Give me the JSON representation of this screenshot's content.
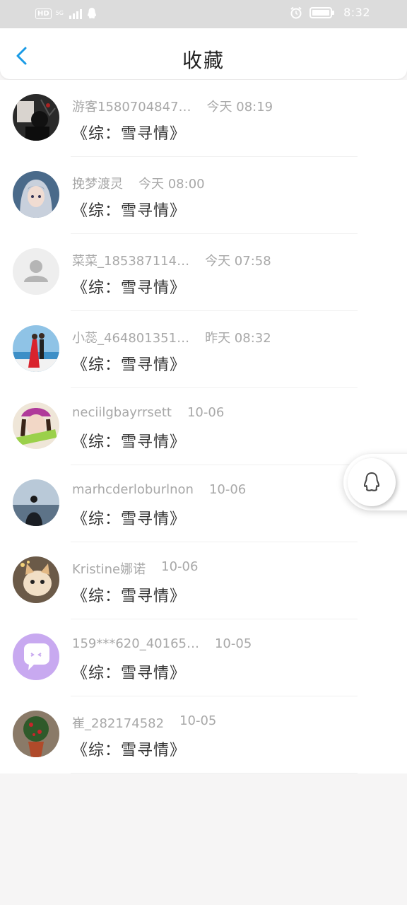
{
  "status_bar": {
    "hd": "HD",
    "network": "5G",
    "time": "8:32",
    "icons": [
      "hd-icon",
      "signal-icon",
      "qq-notification-icon",
      "alarm-icon",
      "battery-icon"
    ]
  },
  "header": {
    "title": "收藏",
    "back_icon": "chevron-left-icon",
    "accent_color": "#1a9be6"
  },
  "favorites": [
    {
      "name": "游客1580704847…",
      "time": "今天 08:19",
      "content": "《综：雪寻情》",
      "avatar": "dark-photo"
    },
    {
      "name": "挽梦渡灵",
      "time": "今天 08:00",
      "content": "《综：雪寻情》",
      "avatar": "anime-girl"
    },
    {
      "name": "菜菜_185387114…",
      "time": "今天 07:58",
      "content": "《综：雪寻情》",
      "avatar": "default-person"
    },
    {
      "name": "小蕊_464801351…",
      "time": "昨天 08:32",
      "content": "《综：雪寻情》",
      "avatar": "couple-sea"
    },
    {
      "name": "neciilgbayrrsett",
      "time": "10-06",
      "content": "《综：雪寻情》",
      "avatar": "girl-purple-hat"
    },
    {
      "name": "marhcderloburlnon",
      "time": "10-06",
      "content": "《综：雪寻情》",
      "avatar": "man-sea"
    },
    {
      "name": "Kristine娜诺",
      "time": "10-06",
      "content": "《综：雪寻情》",
      "avatar": "kitten"
    },
    {
      "name": "159***620_40165…",
      "time": "10-05",
      "content": "《综：雪寻情》",
      "avatar": "chat-bubble"
    },
    {
      "name": "崔_282174582",
      "time": "10-05",
      "content": "《综：雪寻情》",
      "avatar": "plant-pot"
    }
  ],
  "floating_button": {
    "icon": "qq-penguin-icon"
  }
}
